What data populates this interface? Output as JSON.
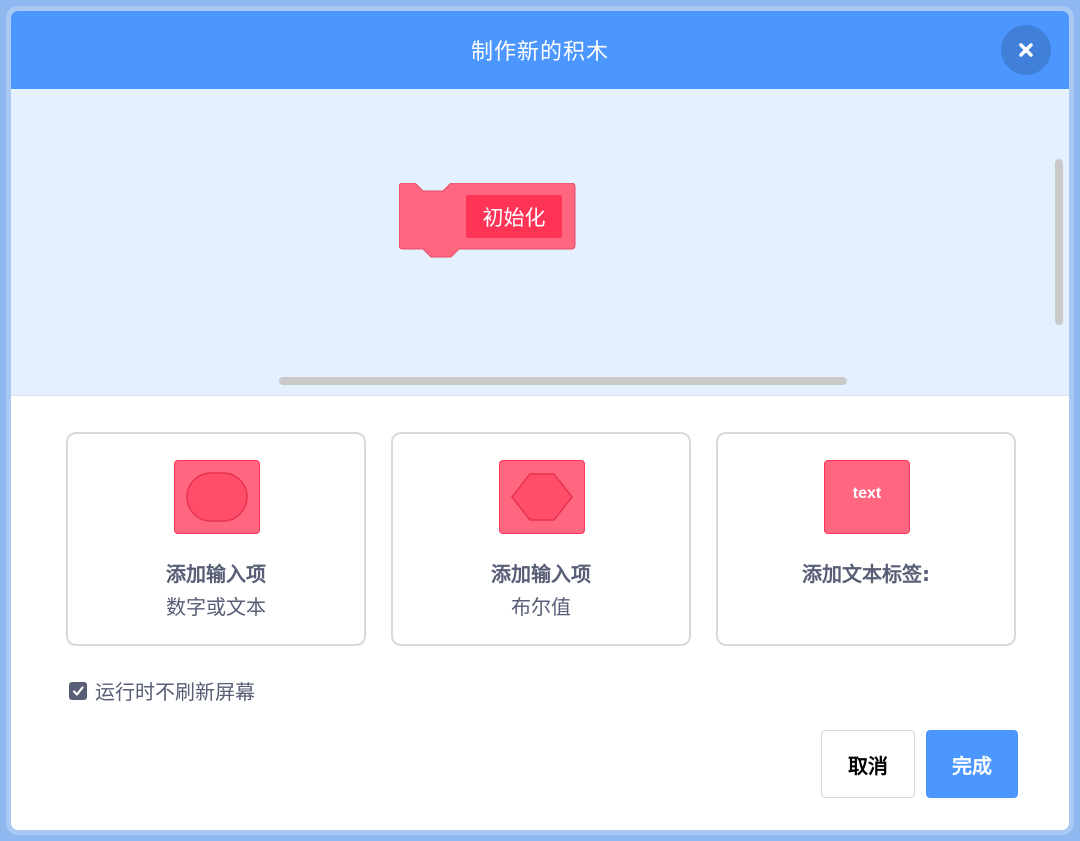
{
  "dialog": {
    "title": "制作新的积木"
  },
  "workspace": {
    "block_label": "初始化",
    "block_color": "#ff6680",
    "block_label_color": "#ff3355"
  },
  "options": [
    {
      "title": "添加输入项",
      "subtitle": "数字或文本",
      "icon": "round-input-icon"
    },
    {
      "title": "添加输入项",
      "subtitle": "布尔值",
      "icon": "hexagon-input-icon"
    },
    {
      "title": "添加文本标签:",
      "subtitle": "",
      "icon": "text-label-icon",
      "icon_text": "text"
    }
  ],
  "run_without_refresh": {
    "label": "运行时不刷新屏幕",
    "checked": true
  },
  "buttons": {
    "cancel": "取消",
    "ok": "完成"
  },
  "colors": {
    "header": "#4c97ff",
    "workspace_bg": "#e5f0ff",
    "text": "#575e75"
  }
}
